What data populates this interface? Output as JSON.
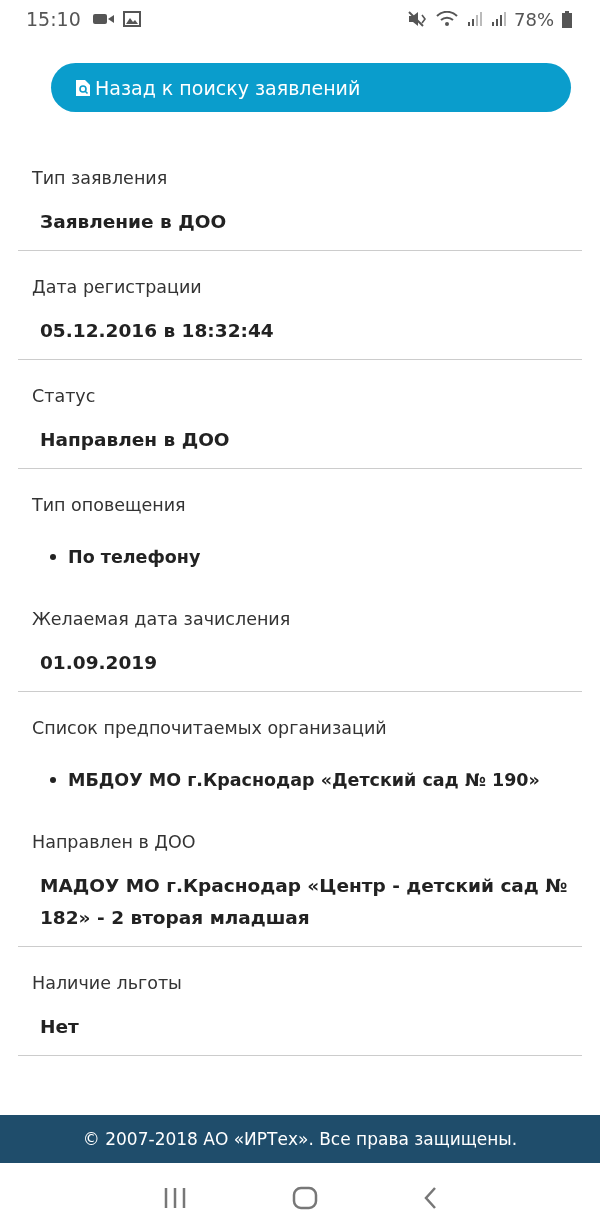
{
  "status_bar": {
    "time": "15:10",
    "battery": "78%"
  },
  "back_button": {
    "label": "Назад к поиску заявлений"
  },
  "fields": [
    {
      "label": "Тип заявления",
      "kind": "text",
      "value": "Заявление в ДОО"
    },
    {
      "label": "Дата регистрации",
      "kind": "text",
      "value": "05.12.2016 в 18:32:44"
    },
    {
      "label": "Статус",
      "kind": "text",
      "value": "Направлен в ДОО"
    },
    {
      "label": "Тип оповещения",
      "kind": "list",
      "items": [
        "По телефону"
      ]
    },
    {
      "label": "Желаемая дата зачисления",
      "kind": "text",
      "value": "01.09.2019"
    },
    {
      "label": "Список предпочитаемых организаций",
      "kind": "list",
      "items": [
        "МБДОУ МО г.Краснодар «Детский сад № 190»"
      ]
    },
    {
      "label": "Направлен в ДОО",
      "kind": "text",
      "value": "МАДОУ МО г.Краснодар «Центр - детский сад № 182» - 2 вторая младшая"
    },
    {
      "label": "Наличие льготы",
      "kind": "text",
      "value": "Нет"
    }
  ],
  "footer": "© 2007-2018 АО «ИРТех». Все права защищены."
}
